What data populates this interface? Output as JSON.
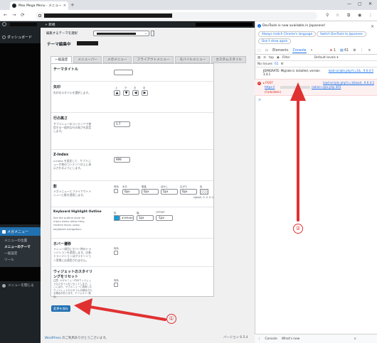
{
  "browser": {
    "tab_title": "Max Mega Menu - メニューのテー",
    "tab_close": "×",
    "new_tab": "+",
    "win_min": "—",
    "win_max": "▢",
    "win_close": "✕"
  },
  "adminbar": {
    "new_label": "+ 新規"
  },
  "sidebar": {
    "dashboard": "ダッシュボード",
    "megamenu": "メガメニュー",
    "sub": [
      "メニューの位置",
      "メニューのテーマ",
      "一般設定",
      "ツール"
    ],
    "collapse": "メニューを閉じる"
  },
  "main": {
    "theme_select_label": "編集するテーマを選択",
    "edit_title": "テーマ編集中",
    "tabs": [
      "一般設定",
      "メニューバー",
      "メガメニュー",
      "フライアウトメニュー",
      "モバイルメニュー",
      "カスタムスタイル"
    ],
    "rows": {
      "theme_title": {
        "label": "テーマタイトル"
      },
      "arrow": {
        "label": "矢印",
        "desc": "矢印のスタイルを選択します。",
        "subs": [
          "上",
          "下",
          "左",
          "右"
        ],
        "vals": [
          "▲",
          "▼",
          "◀",
          "▶"
        ]
      },
      "line_height": {
        "label": "行の高さ",
        "desc": "サブメニューのコンテンツで使用する一般的な行の高さを設定します。",
        "value": "1.7"
      },
      "zindex": {
        "label": "Z-Index",
        "desc": "z-index を設定して、サブメニューが他のコンテンツの上に表示されるようにします。",
        "value": "999"
      },
      "shadow": {
        "label": "影",
        "desc": "メガメニューとフライアウトメニューに影を適用します。",
        "subs": [
          "有効",
          "水平",
          "垂直",
          "ぼかし",
          "広がり",
          "色"
        ],
        "vals": [
          "0px",
          "0px",
          "5px",
          "0px"
        ],
        "color": "rgba(0, 0, 0, 0.1)"
      },
      "focus": {
        "label": "Keyboard Highlight Outline",
        "desc": "Set the outline style for menu items when they receive focus using keyboard navigation.",
        "subs": [
          "色",
          "幅",
          "OFFSET"
        ],
        "vals": [
          "#109cde",
          "1px",
          "-1px"
        ],
        "color_hex": "#109cde"
      },
      "hover": {
        "label": "ホバー遷移",
        "desc": "メニュー項目にホバー時のトランジションを適用します。注意: トランジションはグラデーション背景には適用されません。",
        "subs": [
          "有効"
        ]
      },
      "reset": {
        "label": "ウィジェットのスタイリングをリセット",
        "desc": "注意: メガメニュー内のウィジェットのスタイルをリセットします。ここにはり、サブメニューに適用したウィジェットのスタイルが維持される場合があります。デフォルト: 無効。",
        "subs": [
          "有効"
        ]
      }
    },
    "save_button": "変更を保存",
    "footer_link": "WordPress",
    "footer_text": " のご利用ありがとうございます。",
    "version": "バージョン 6.5.4"
  },
  "devtools": {
    "info_text": "DevTools is now available in Japanese!",
    "pill1": "Always match Chrome's language",
    "pill2": "Switch DevTools to Japanese",
    "pill3": "Don't show again",
    "tabs": [
      "Elements",
      "Console",
      "»"
    ],
    "err_count": "1",
    "msg_count": "61",
    "toolbar": [
      "top",
      "Filter",
      "Default levels ▾"
    ],
    "issues": "No Issues",
    "issues_count": "61",
    "log1": "JQMIGRATE: Migrate is installed, version 3.4.1",
    "log1_src": "load-scripts.php?c=1&...9.6.4:5",
    "err_l1": "▸ POST",
    "err_src": "load-scripts.php?c=1&load...9.6.4:2",
    "err_l2": "https://",
    "err_l2_tail": "/admin-ajax.php 403",
    "err_l3": "(Forbidden)",
    "prompt": ">",
    "drawer": [
      "Console",
      "What's new"
    ]
  },
  "annotations": {
    "one": "①",
    "two": "②",
    "color": "#e03131"
  }
}
